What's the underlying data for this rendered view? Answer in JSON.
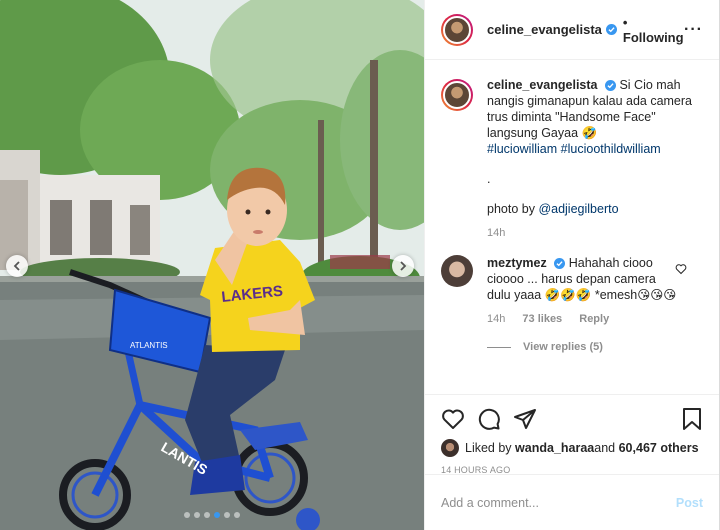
{
  "header": {
    "username": "celine_evangelista",
    "follow_status": "• Following",
    "more_label": "···"
  },
  "caption": {
    "username": "celine_evangelista",
    "text": "Si Cio mah nangis gimanapun kalau ada camera trus diminta \"Handsome Face\" langsung Gayaa 🤣",
    "hashtag1": "#luciowilliam",
    "hashtag2": "#lucioothildwilliam",
    "dot": ".",
    "photo_by": "photo by ",
    "mention": "@adjiegilberto",
    "time": "14h"
  },
  "comment": {
    "username": "meztymez",
    "text": "Hahahah ciooo cioooo ... harus depan camera dulu yaaa 🤣🤣🤣 *emesh😘😘😘",
    "time": "14h",
    "likes": "73 likes",
    "reply": "Reply",
    "view_replies": "View replies (5)"
  },
  "likes": {
    "prefix": "Liked by ",
    "user": "wanda_haraa",
    "and": " and ",
    "count": "60,467 others"
  },
  "timestamp": "14 HOURS AGO",
  "add_comment": {
    "placeholder": "Add a comment...",
    "post_label": "Post"
  },
  "photo": {
    "shirt_text": "LAKERS",
    "bike_text": "LANTIS",
    "basket_text": "ATLANTIS",
    "carousel_dots": 6,
    "active_dot": 4
  },
  "colors": {
    "verified_blue": "#3897f0",
    "link": "#00376b",
    "muted": "#8e8e8e",
    "post_disabled": "#b2dffc",
    "shirt_yellow": "#f5d31d",
    "bike_blue": "#1f4fd1"
  }
}
